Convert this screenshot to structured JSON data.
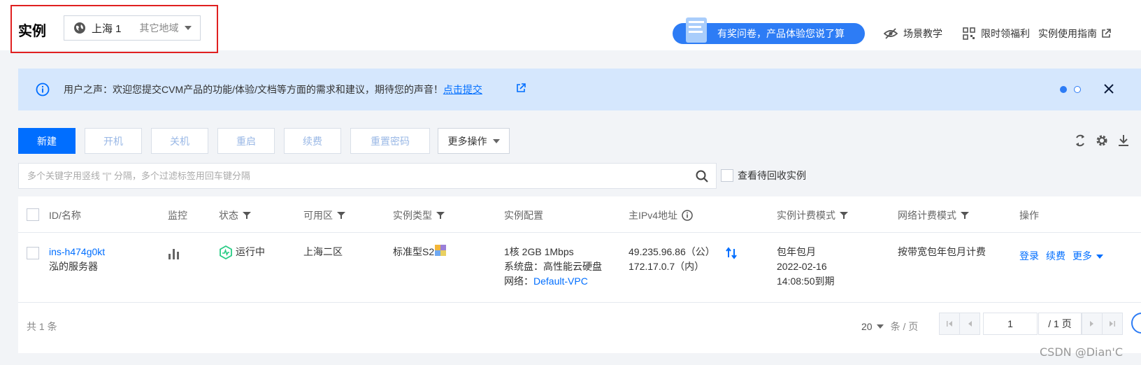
{
  "header": {
    "title": "实例",
    "region_current": "上海 1",
    "region_other": "其它地域",
    "survey_text": "有奖问卷，产品体验您说了算",
    "links": [
      "场景教学",
      "限时领福利",
      "实例使用指南"
    ]
  },
  "banner": {
    "text": "用户之声：欢迎您提交CVM产品的功能/体验/文档等方面的需求和建议，期待您的声音！",
    "link": "点击提交"
  },
  "toolbar": {
    "new": "新建",
    "start": "开机",
    "stop": "关机",
    "restart": "重启",
    "renew": "续费",
    "reset_password": "重置密码",
    "more": "更多操作"
  },
  "search": {
    "placeholder": "多个关键字用竖线 \"|\" 分隔，多个过滤标签用回车键分隔",
    "recycle_label": "查看待回收实例"
  },
  "table": {
    "columns": [
      "ID/名称",
      "监控",
      "状态",
      "可用区",
      "实例类型",
      "实例配置",
      "主IPv4地址",
      "实例计费模式",
      "网络计费模式",
      "操作"
    ],
    "rows": [
      {
        "id": "ins-h474g0kt",
        "name": "泓的服务器",
        "status": "运行中",
        "zone": "上海二区",
        "type": "标准型S2",
        "config_line1": "1核 2GB 1Mbps",
        "config_line2": "系统盘：高性能云硬盘",
        "config_net_label": "网络：",
        "config_net_value": "Default-VPC",
        "ip_public": "49.235.96.86（公）",
        "ip_private": "172.17.0.7（内）",
        "billing_mode": "包年包月",
        "billing_date": "2022-02-16",
        "billing_expire": "14:08:50到期",
        "net_billing": "按带宽包年包月计费",
        "actions": [
          "登录",
          "续费",
          "更多"
        ]
      }
    ]
  },
  "footer": {
    "total": "共 1 条",
    "page_size": "20",
    "page_size_unit": "条 / 页",
    "page_current": "1",
    "page_total": "/ 1 页"
  },
  "watermark": "CSDN @Dian'C",
  "colors": {
    "primary": "#006eff",
    "highlight": "#e02020",
    "banner_bg": "#d5e7fd",
    "running": "#29cc85"
  }
}
